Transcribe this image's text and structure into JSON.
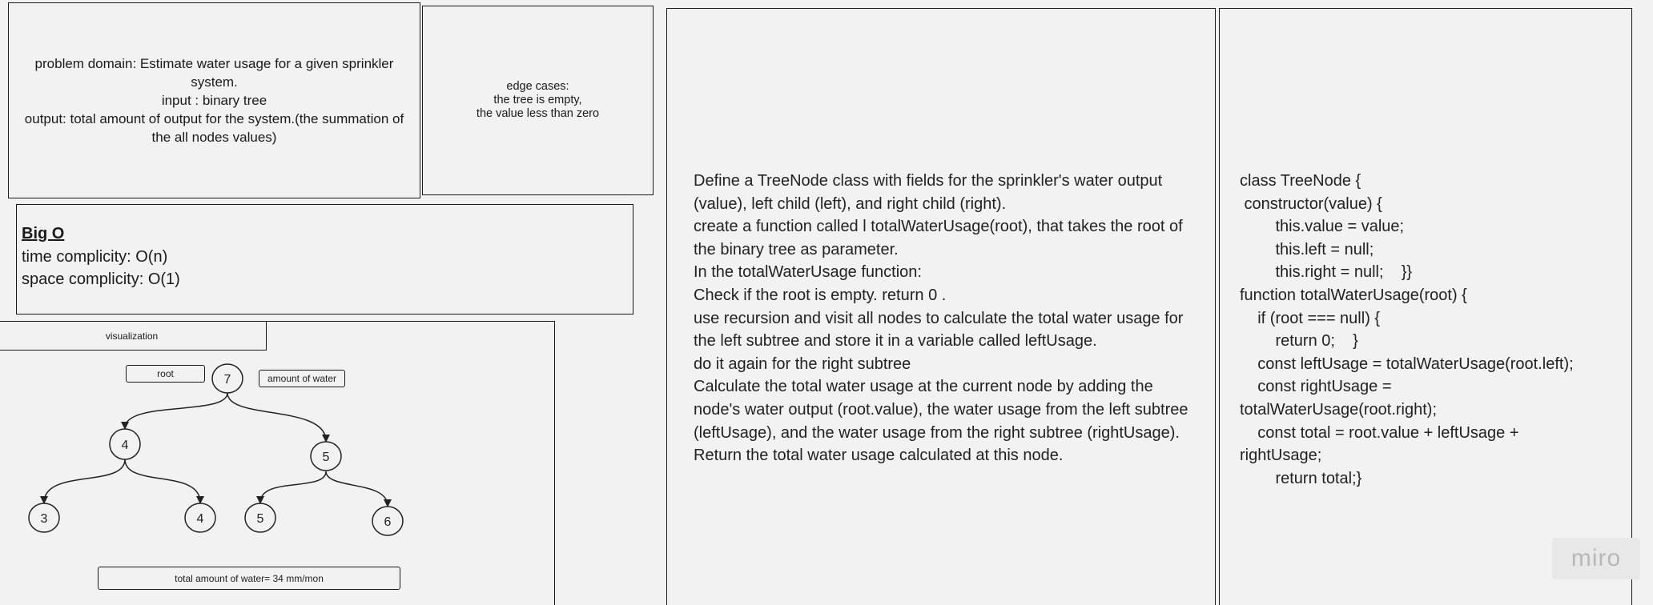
{
  "problem": {
    "lines": [
      "problem domain: Estimate water usage for a given sprinkler system.",
      "input :  binary tree",
      "output: total amount of output for the system.(the summation of the all nodes values)"
    ]
  },
  "edge_cases": {
    "lines": [
      "edge cases:",
      "the tree is empty,",
      "the value less than zero"
    ]
  },
  "big_o": {
    "title": "Big O",
    "time": "time complicity: O(n)",
    "space": "space complicity: O(1)"
  },
  "visualization": {
    "label": "visualization",
    "root_label": "root",
    "water_label": "amount of water",
    "total_label": "total amount of water= 34 mm/mon",
    "nodes": {
      "root": "7",
      "left": "4",
      "right": "5",
      "left_left": "3",
      "left_right": "4",
      "right_left": "5",
      "right_right": "6"
    }
  },
  "algorithm": {
    "lines": [
      "Define a TreeNode class with fields for the sprinkler's water output (value), left child (left), and right child (right).",
      "create a function called l  totalWaterUsage(root), that takes the root of the binary tree as  parameter.",
      "In the totalWaterUsage function:",
      "Check if the root is empty.  return 0 .",
      "use recursion and visit all nodes to calculate the total water usage for the left subtree and store it in a variable called leftUsage.",
      "do it again for the right subtree",
      "Calculate the total water usage at the current node by adding the node's water output (root.value), the water usage from the left subtree (leftUsage), and the water usage from the right subtree (rightUsage).",
      "Return the total water usage calculated at this node."
    ]
  },
  "code": {
    "lines": [
      "class TreeNode {",
      " constructor(value) {",
      "        this.value = value;",
      "        this.left = null;",
      "        this.right = null;    }}",
      "function totalWaterUsage(root) {",
      "    if (root === null) {",
      "        return 0;    }",
      "    const leftUsage = totalWaterUsage(root.left);",
      "    const rightUsage =",
      "totalWaterUsage(root.right);",
      "    const total = root.value + leftUsage +",
      "rightUsage;",
      "        return total;}"
    ]
  },
  "brand": {
    "logo_text": "miro"
  }
}
